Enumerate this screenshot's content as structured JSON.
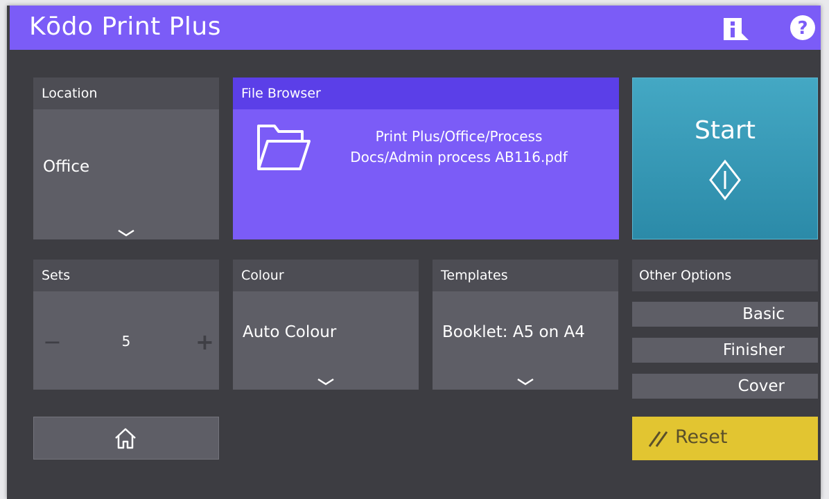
{
  "header": {
    "title": "Kōdo Print Plus"
  },
  "location": {
    "label": "Location",
    "value": "Office"
  },
  "file_browser": {
    "label": "File Browser",
    "path_line1": "Print Plus/Office/Process",
    "path_line2": "Docs/Admin process AB116.pdf"
  },
  "start": {
    "label": "Start"
  },
  "sets": {
    "label": "Sets",
    "value": "5",
    "minus": "−",
    "plus": "+"
  },
  "colour": {
    "label": "Colour",
    "value": "Auto Colour"
  },
  "templates": {
    "label": "Templates",
    "value": "Booklet: A5 on A4"
  },
  "other_options": {
    "label": "Other Options",
    "buttons": [
      "Basic",
      "Finisher",
      "Cover"
    ]
  },
  "reset": {
    "label": "Reset"
  },
  "colors": {
    "header": "#7b5cf7",
    "file_browser": "#7b5cf7",
    "start": "#2b8aa8",
    "reset": "#e2c531",
    "background": "#3d3d42",
    "tile": "#5e5e66"
  },
  "icons": {
    "info": "info-icon",
    "help": "help-icon",
    "folder": "folder-icon",
    "start": "start-icon",
    "home": "home-icon",
    "reset": "reset-icon",
    "dropdown": "chevron-down-icon"
  }
}
